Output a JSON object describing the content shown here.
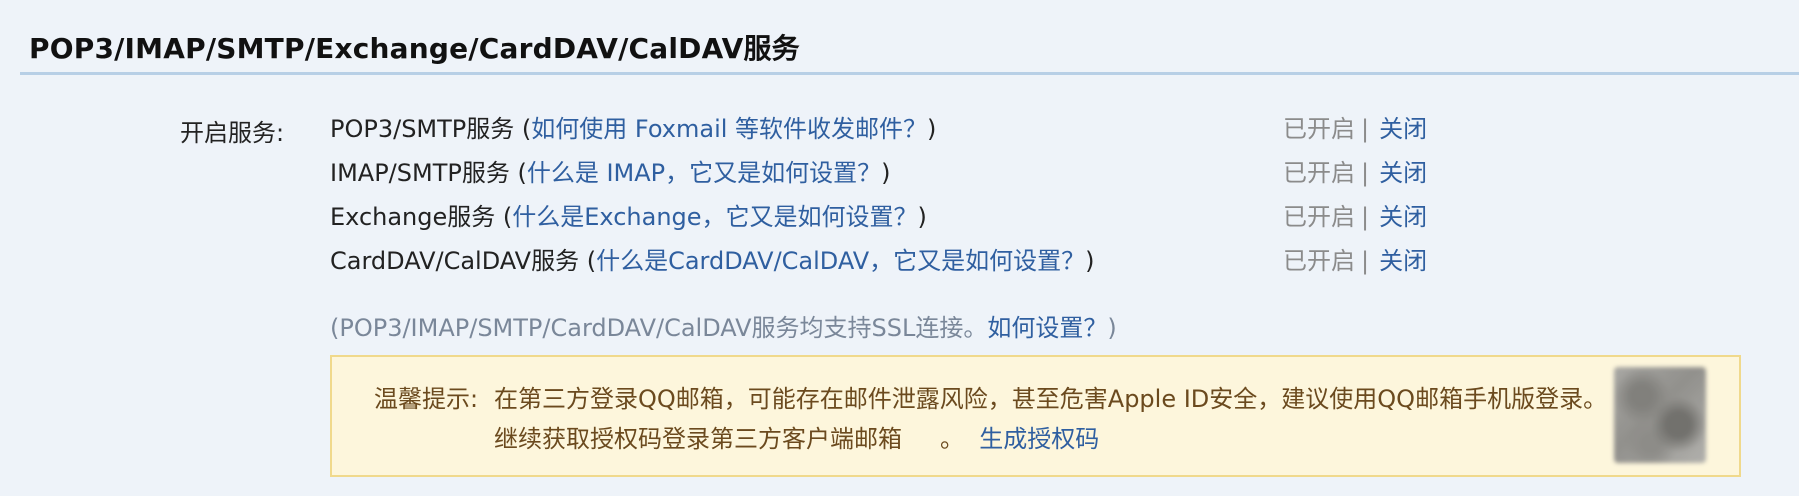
{
  "section": {
    "title": "POP3/IMAP/SMTP/Exchange/CardDAV/CalDAV服务"
  },
  "services": {
    "label": "开启服务:",
    "items": [
      {
        "name": "POP3/SMTP服务 (",
        "help": "如何使用 Foxmail 等软件收发邮件？",
        "end": ")",
        "status": "已开启",
        "separator": "|",
        "action": "关闭"
      },
      {
        "name": "IMAP/SMTP服务 (",
        "help": "什么是 IMAP，它又是如何设置？",
        "end": ")",
        "status": "已开启",
        "separator": "|",
        "action": "关闭"
      },
      {
        "name": "Exchange服务 (",
        "help": "什么是Exchange，它又是如何设置？",
        "end": ")",
        "status": "已开启",
        "separator": "|",
        "action": "关闭"
      },
      {
        "name": "CardDAV/CalDAV服务 (",
        "help": "什么是CardDAV/CalDAV，它又是如何设置？",
        "end": ")",
        "status": "已开启",
        "separator": "|",
        "action": "关闭"
      }
    ],
    "ssl_note_prefix": "(POP3/IMAP/SMTP/CardDAV/CalDAV服务均支持SSL连接。",
    "ssl_note_link": "如何设置？",
    "ssl_note_suffix": ")"
  },
  "tip": {
    "prefix": "温馨提示:",
    "line1": "在第三方登录QQ邮箱，可能存在邮件泄露风险，甚至危害Apple ID安全，建议使用QQ邮箱手机版登录。",
    "line2_text": "继续获取授权码登录第三方客户端邮箱",
    "line2_dot": "。",
    "line2_link": "生成授权码"
  },
  "colors": {
    "background": "#eef3f9",
    "link": "#2f5fa0",
    "tip_bg": "#fdf6dc",
    "tip_border": "#f0d98c",
    "tip_text": "#6b4a1e"
  },
  "icons": {
    "qr_code": "qr-code-icon"
  }
}
